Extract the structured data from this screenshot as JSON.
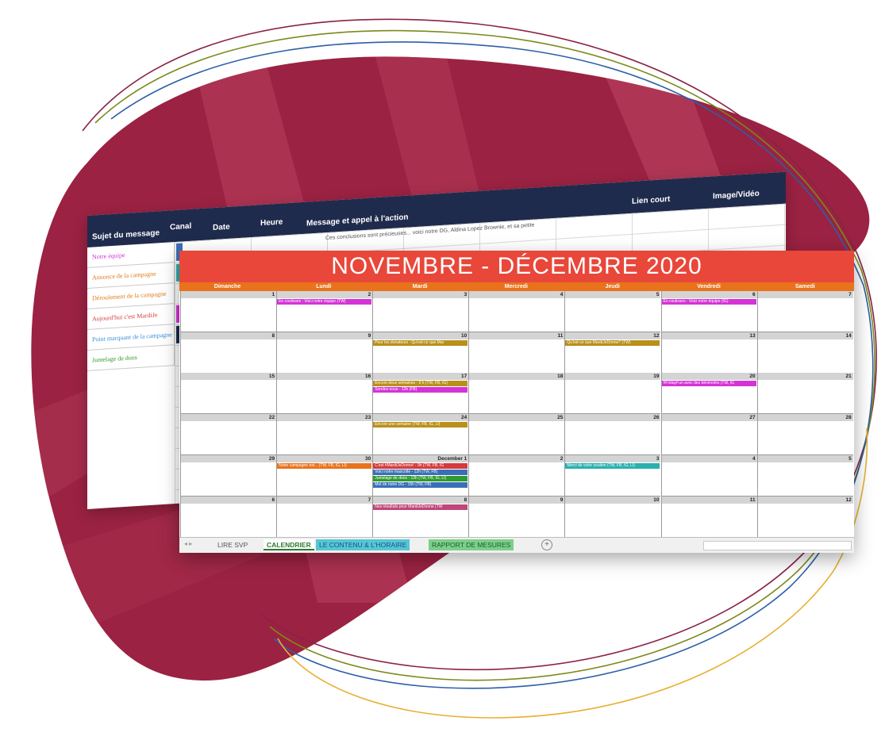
{
  "back_sheet": {
    "headers": [
      "Sujet du message",
      "Canal",
      "Date",
      "Heure",
      "Message et appel à l'action",
      "Lien court",
      "Image/Vidéo"
    ],
    "row_preview": "Ces conclusions sont précieuses... voici notre DG, Aldina Lopez Brownie, et sa petite",
    "subjects": [
      {
        "text": "Notre équipe",
        "color": "#d633d6"
      },
      {
        "text": "Annonce de la campagne",
        "color": "#e07a1a"
      },
      {
        "text": "Déroulement de la campagne",
        "color": "#e07a1a"
      },
      {
        "text": "Aujourd'hui c'est MardiJe",
        "color": "#d63a3a"
      },
      {
        "text": "Point marquant de la campagne",
        "color": "#3a8fd6"
      },
      {
        "text": "Jumelage de dons",
        "color": "#2f9a2f"
      }
    ]
  },
  "calendar": {
    "title": "NOVEMBRE - DÉCEMBRE 2020",
    "days": [
      "Dimanche",
      "Lundi",
      "Mardi",
      "Mercredi",
      "Jeudi",
      "Vendredi",
      "Samedi"
    ],
    "weeks": [
      {
        "dates": [
          "1",
          "2",
          "3",
          "4",
          "5",
          "6",
          "7"
        ],
        "events": [
          {
            "day": 1,
            "slot": 0,
            "text": "En coulisses : Voici notre équipe (TW)",
            "color": "#d633d6"
          },
          {
            "day": 5,
            "slot": 0,
            "text": "En coulisses : Voici notre équipe (IG)",
            "color": "#d633d6"
          }
        ]
      },
      {
        "dates": [
          "8",
          "9",
          "10",
          "11",
          "12",
          "13",
          "14"
        ],
        "events": [
          {
            "day": 2,
            "slot": 0,
            "text": "Pour les donateurs : Qu'est-ce que Mar",
            "color": "#b8901a"
          },
          {
            "day": 4,
            "slot": 0,
            "text": "Qu'est-ce que MardiJeDonne? (TW)",
            "color": "#b8901a"
          }
        ]
      },
      {
        "dates": [
          "15",
          "16",
          "17",
          "18",
          "19",
          "20",
          "21"
        ],
        "events": [
          {
            "day": 2,
            "slot": 0,
            "text": "Encore deux semaines - 9 h (TW, FB, IG)",
            "color": "#b8901a"
          },
          {
            "day": 2,
            "slot": 1,
            "text": "Sondez-vous - 12h (FB)",
            "color": "#d633d6"
          },
          {
            "day": 5,
            "slot": 0,
            "text": "#FridayFun avec des bénévoles (TW, IG",
            "color": "#d633d6"
          }
        ]
      },
      {
        "dates": [
          "22",
          "23",
          "24",
          "25",
          "26",
          "27",
          "28"
        ],
        "events": [
          {
            "day": 2,
            "slot": 0,
            "text": "Encore une semaine (TW, FB, IG, LI)",
            "color": "#b8901a"
          }
        ]
      },
      {
        "dates": [
          "29",
          "30",
          "December 1",
          "2",
          "3",
          "4",
          "5"
        ],
        "events": [
          {
            "day": 1,
            "slot": 0,
            "text": "Notre campagne est... (TW, FB, IG, LI)",
            "color": "#e9731c"
          },
          {
            "day": 2,
            "slot": 0,
            "text": "C'est #MardiJeDonne! - 9h (TW, FB, IG",
            "color": "#d63a3a"
          },
          {
            "day": 2,
            "slot": 1,
            "text": "Voici notre mascotte - 12h (TW, FB)",
            "color": "#3a6fb8"
          },
          {
            "day": 2,
            "slot": 2,
            "text": "Jumelage de dons - 13h (TW, FB, IG, LI)",
            "color": "#2f9a2f"
          },
          {
            "day": 2,
            "slot": 3,
            "text": "Mot de notre DG - 15h (TW, FB)",
            "color": "#3a6fb8"
          },
          {
            "day": 4,
            "slot": 0,
            "text": "Merci de votre soutien (TW, FB, IG, LI)",
            "color": "#2ab0b0"
          }
        ]
      },
      {
        "dates": [
          "6",
          "7",
          "8",
          "9",
          "10",
          "11",
          "12"
        ],
        "events": [
          {
            "day": 2,
            "slot": 0,
            "text": "Nos résultats pour MardiJeDonne (TW",
            "color": "#c0467a"
          }
        ]
      }
    ]
  },
  "tabs": [
    {
      "label": "LIRE SVP",
      "bg": "#f0f0f0",
      "fg": "#555555",
      "active": false
    },
    {
      "label": "CALENDRIER",
      "bg": "#ffffff",
      "fg": "#2f7a2f",
      "active": true
    },
    {
      "label": "LE CONTENU & L'HORAIRE",
      "bg": "#55c7d3",
      "fg": "#1c4f8a",
      "active": false
    },
    {
      "label": "RAPPORT DE MESURES",
      "bg": "#7ccf8a",
      "fg": "#1e5a2a",
      "active": false
    }
  ],
  "add_sheet_icon": "plus-circle-icon",
  "colors": {
    "blob": "#9b2242",
    "title_bar": "#e8473a",
    "day_bar": "#e9731c",
    "header_navy": "#1f2b4d"
  }
}
